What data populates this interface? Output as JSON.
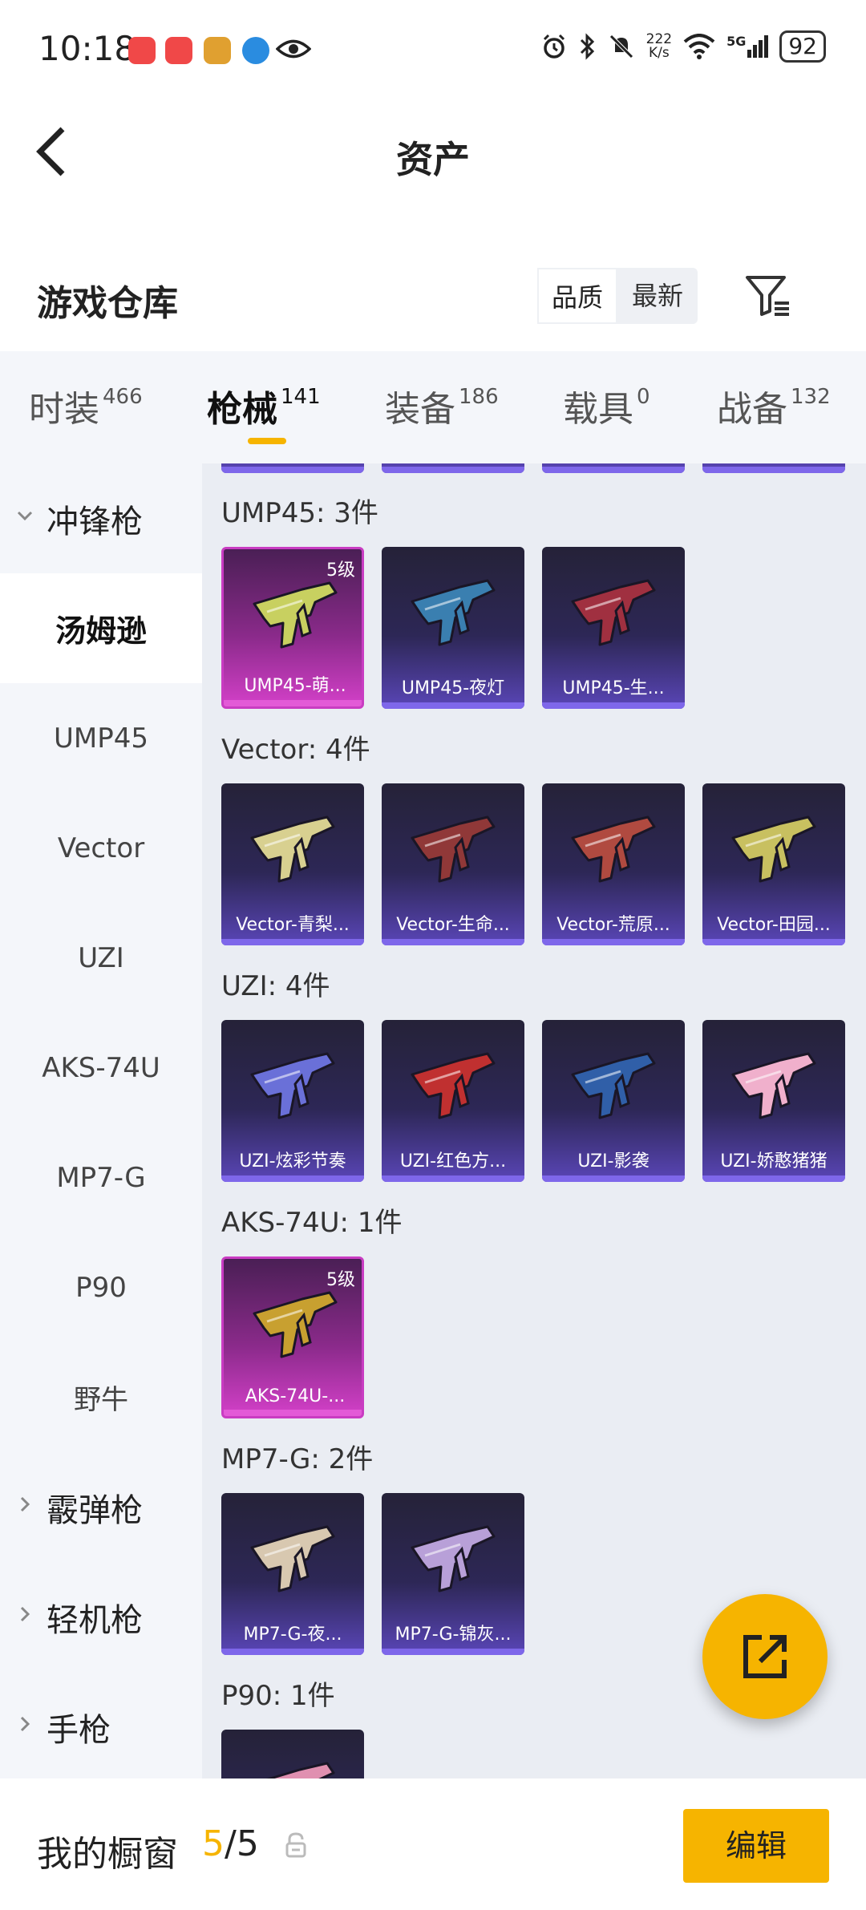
{
  "status_bar": {
    "time": "10:18",
    "net_speed_value": "222",
    "net_speed_unit": "K/s",
    "network_label": "5G",
    "battery": "92"
  },
  "nav": {
    "title": "资产"
  },
  "section": {
    "title": "游戏仓库",
    "sort_options": [
      "品质",
      "最新"
    ],
    "selected_sort": "品质"
  },
  "tabs": [
    {
      "label": "时装",
      "count": "466"
    },
    {
      "label": "枪械",
      "count": "141"
    },
    {
      "label": "装备",
      "count": "186"
    },
    {
      "label": "载具",
      "count": "0"
    },
    {
      "label": "战备",
      "count": "132"
    }
  ],
  "active_tab": "枪械",
  "sidebar": {
    "categories": [
      {
        "label": "冲锋枪",
        "type": "group",
        "expanded": true
      },
      {
        "label": "汤姆逊",
        "type": "sub",
        "selected": true
      },
      {
        "label": "UMP45",
        "type": "sub"
      },
      {
        "label": "Vector",
        "type": "sub"
      },
      {
        "label": "UZI",
        "type": "sub"
      },
      {
        "label": "AKS-74U",
        "type": "sub"
      },
      {
        "label": "MP7-G",
        "type": "sub"
      },
      {
        "label": "P90",
        "type": "sub"
      },
      {
        "label": "野牛",
        "type": "sub"
      },
      {
        "label": "霰弹枪",
        "type": "group",
        "expanded": false
      },
      {
        "label": "轻机枪",
        "type": "group",
        "expanded": false
      },
      {
        "label": "手枪",
        "type": "group",
        "expanded": false
      }
    ]
  },
  "groups": [
    {
      "label": "UMP45: 3件",
      "items": [
        {
          "name": "UMP45-萌...",
          "level": "5级",
          "rarity": "pink",
          "color": "#c8d060"
        },
        {
          "name": "UMP45-夜灯",
          "rarity": "purple",
          "color": "#3a7fb0"
        },
        {
          "name": "UMP45-生...",
          "rarity": "purple",
          "color": "#a03040"
        }
      ]
    },
    {
      "label": "Vector: 4件",
      "items": [
        {
          "name": "Vector-青梨...",
          "rarity": "purple",
          "color": "#d8d090"
        },
        {
          "name": "Vector-生命...",
          "rarity": "purple",
          "color": "#903838"
        },
        {
          "name": "Vector-荒原...",
          "rarity": "purple",
          "color": "#b04a40"
        },
        {
          "name": "Vector-田园...",
          "rarity": "purple",
          "color": "#c8c060"
        }
      ]
    },
    {
      "label": "UZI: 4件",
      "items": [
        {
          "name": "UZI-炫彩节奏",
          "rarity": "purple",
          "color": "#6a70d8"
        },
        {
          "name": "UZI-红色方...",
          "rarity": "purple",
          "color": "#c03030"
        },
        {
          "name": "UZI-影袭",
          "rarity": "purple",
          "color": "#305fa8"
        },
        {
          "name": "UZI-娇憨猪猪",
          "rarity": "purple",
          "color": "#f0b0cc"
        }
      ]
    },
    {
      "label": "AKS-74U: 1件",
      "items": [
        {
          "name": "AKS-74U-...",
          "level": "5级",
          "rarity": "pink",
          "color": "#c8a030"
        }
      ]
    },
    {
      "label": "MP7-G: 2件",
      "items": [
        {
          "name": "MP7-G-夜...",
          "rarity": "purple",
          "color": "#d8c8b0"
        },
        {
          "name": "MP7-G-锦灰...",
          "rarity": "purple",
          "color": "#b8a0d8"
        }
      ]
    },
    {
      "label": "P90: 1件",
      "items": [
        {
          "name": "",
          "rarity": "purple",
          "color": "#e090b0"
        }
      ]
    }
  ],
  "bottom_bar": {
    "label": "我的橱窗",
    "count_current": "5",
    "count_separator": "/",
    "count_total": "5",
    "edit_label": "编辑"
  },
  "colors": {
    "accent": "#f6b400",
    "card_purple": "#5a46b8",
    "card_pink": "#d340c8"
  }
}
